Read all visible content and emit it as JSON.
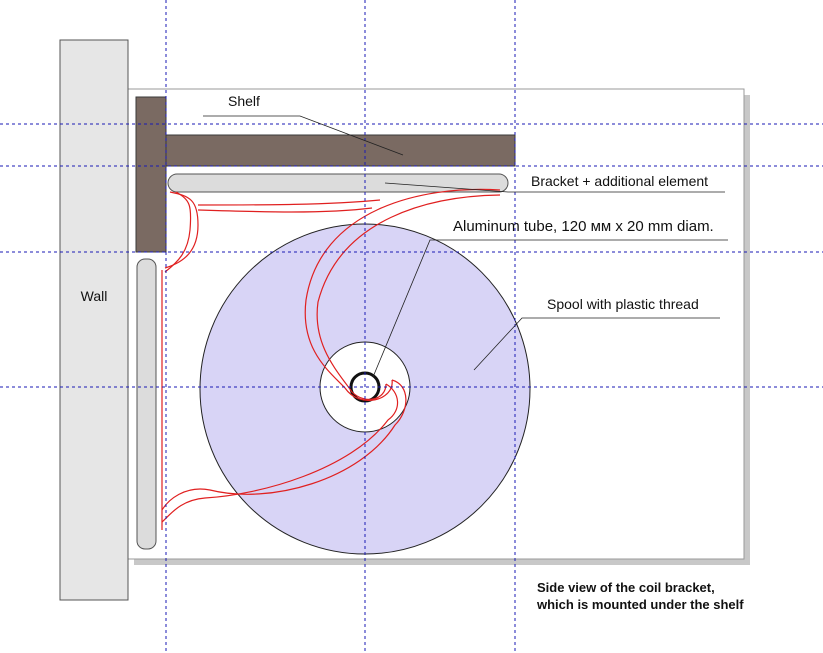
{
  "labels": {
    "wall": "Wall",
    "shelf": "Shelf",
    "bracket": "Bracket + additional element",
    "tube": "Aluminum tube, 120 мм x 20 mm diam.",
    "spool": "Spool with plastic thread"
  },
  "caption": {
    "line1": "Side view of the coil bracket,",
    "line2": "which is mounted under the shelf"
  },
  "colors": {
    "wall_fill": "#e6e6e6",
    "shelf_fill": "#7a6a62",
    "bracket_fill": "#dcdcdc",
    "spool_fill": "#d8d4f6",
    "thread": "#e02020",
    "guide_lines": "#1a1ab4",
    "panel_shadow": "#c8c8c8"
  }
}
